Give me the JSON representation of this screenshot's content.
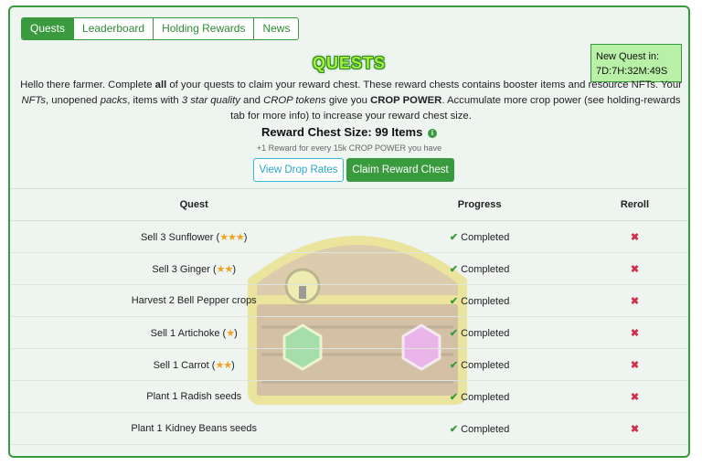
{
  "tabs": [
    "Quests",
    "Leaderboard",
    "Holding Rewards",
    "News"
  ],
  "new_quest": {
    "label": "New Quest in:",
    "countdown": "7D:7H:32M:49S"
  },
  "title": "QUESTS",
  "intro": {
    "p1": "Hello there farmer. Complete ",
    "p1b": "all",
    "p2": " of your quests to claim your reward chest. These reward chests contains booster items and resource NFTs. Your ",
    "p2i": "NFTs",
    "p3": ", unopened ",
    "p3i": "packs",
    "p4": ", items with ",
    "p4i": "3 star quality",
    "p5": " and ",
    "p5i": "CROP tokens",
    "p6": " give you ",
    "p6b": "CROP POWER",
    "p7": ". Accumulate more crop power (see holding-rewards tab for more info) to increase your reward chest size."
  },
  "reward_chest": {
    "size_text": "Reward Chest Size: 99 Items",
    "info_icon": "info-icon",
    "sub": "+1 Reward for every 15k CROP POWER you have"
  },
  "buttons": {
    "drop_rates": "View Drop Rates",
    "claim": "Claim Reward Chest"
  },
  "table": {
    "headers": {
      "quest": "Quest",
      "progress": "Progress",
      "reroll": "Reroll"
    },
    "rows": [
      {
        "name": "Sell 3 Sunflower",
        "stars": "★★★",
        "progress": "Completed"
      },
      {
        "name": "Sell 3 Ginger",
        "stars": "★★",
        "progress": "Completed"
      },
      {
        "name": "Harvest 2 Bell Pepper crops",
        "stars": "",
        "progress": "Completed"
      },
      {
        "name": "Sell 1 Artichoke",
        "stars": "★",
        "progress": "Completed"
      },
      {
        "name": "Sell 1 Carrot",
        "stars": "★★",
        "progress": "Completed"
      },
      {
        "name": "Plant 1 Radish seeds",
        "stars": "",
        "progress": "Completed"
      },
      {
        "name": "Plant 1 Kidney Beans seeds",
        "stars": "",
        "progress": "Completed"
      }
    ]
  },
  "icons": {
    "check": "check-icon",
    "reroll": "close-icon",
    "star": "star-icon"
  },
  "colors": {
    "accent": "#3a9a3e",
    "star": "#f2a122",
    "reroll": "#d0304a",
    "info_button": "#2aa5c8"
  }
}
